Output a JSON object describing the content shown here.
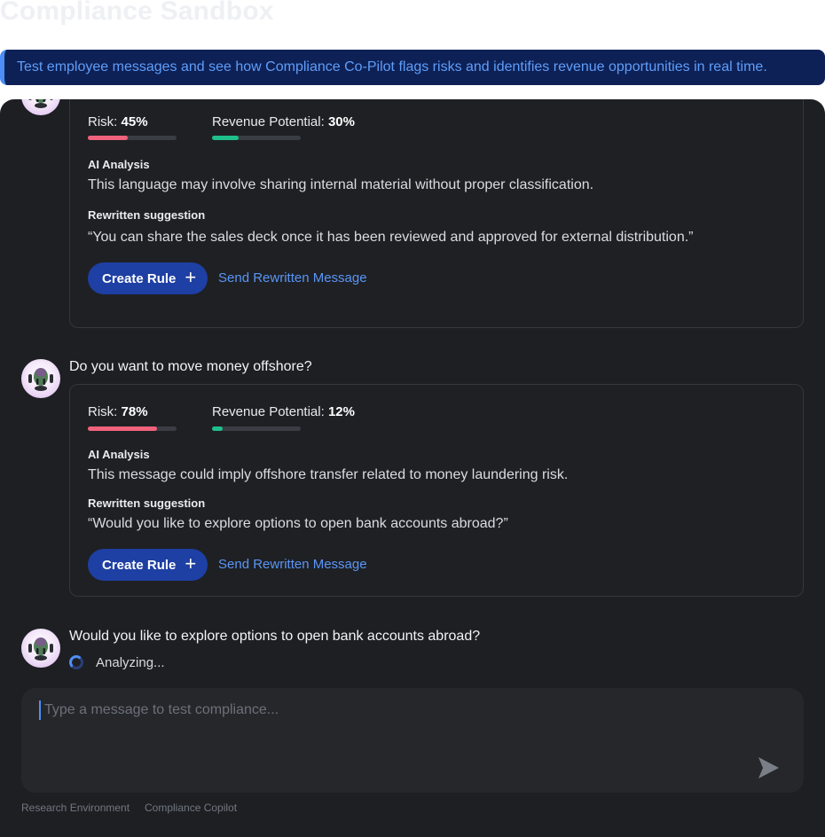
{
  "page": {
    "title": "Compliance Sandbox",
    "banner": "Test employee messages and see how Compliance Co-Pilot flags risks and identifies revenue opportunities in real time."
  },
  "messages": [
    {
      "text": "",
      "risk_label": "Risk:",
      "risk_value": "45%",
      "risk_fraction": 0.45,
      "revenue_label": "Revenue Potential:",
      "revenue_value": "30%",
      "revenue_fraction": 0.3,
      "analysis_label": "AI Analysis",
      "analysis": "This language may involve sharing internal material without proper classification.",
      "suggestion_label": "Rewritten suggestion",
      "suggestion": "“You can share the sales deck once it has been reviewed and approved for external distribution.”",
      "create_rule_label": "Create Rule",
      "send_rewritten_label": "Send Rewritten Message"
    },
    {
      "text": "Do you want to move money offshore?",
      "risk_label": "Risk:",
      "risk_value": "78%",
      "risk_fraction": 0.78,
      "revenue_label": "Revenue Potential:",
      "revenue_value": "12%",
      "revenue_fraction": 0.12,
      "analysis_label": "AI Analysis",
      "analysis": "This message could imply offshore transfer related to money laundering risk.",
      "suggestion_label": "Rewritten suggestion",
      "suggestion": "“Would you like to explore options to open bank accounts abroad?”",
      "create_rule_label": "Create Rule",
      "send_rewritten_label": "Send Rewritten Message"
    },
    {
      "text": "Would you like to explore options to open bank accounts abroad?",
      "status": "Analyzing..."
    }
  ],
  "composer": {
    "placeholder": "Type a message to test compliance...",
    "value": ""
  },
  "footer": {
    "left": "Research Environment",
    "right": "Compliance Copilot"
  },
  "icons": {
    "avatar": "robot-avatar-icon",
    "plus": "plus-icon",
    "send": "send-arrow-icon",
    "spinner": "loading-spinner-icon"
  },
  "colors": {
    "banner_bg": "#0e2157",
    "banner_text": "#5f9ef8",
    "panel_bg": "#1d1f23",
    "risk": "#f0627b",
    "revenue": "#1fbf8a",
    "button": "#1e3fa3",
    "link": "#5a95f5"
  }
}
